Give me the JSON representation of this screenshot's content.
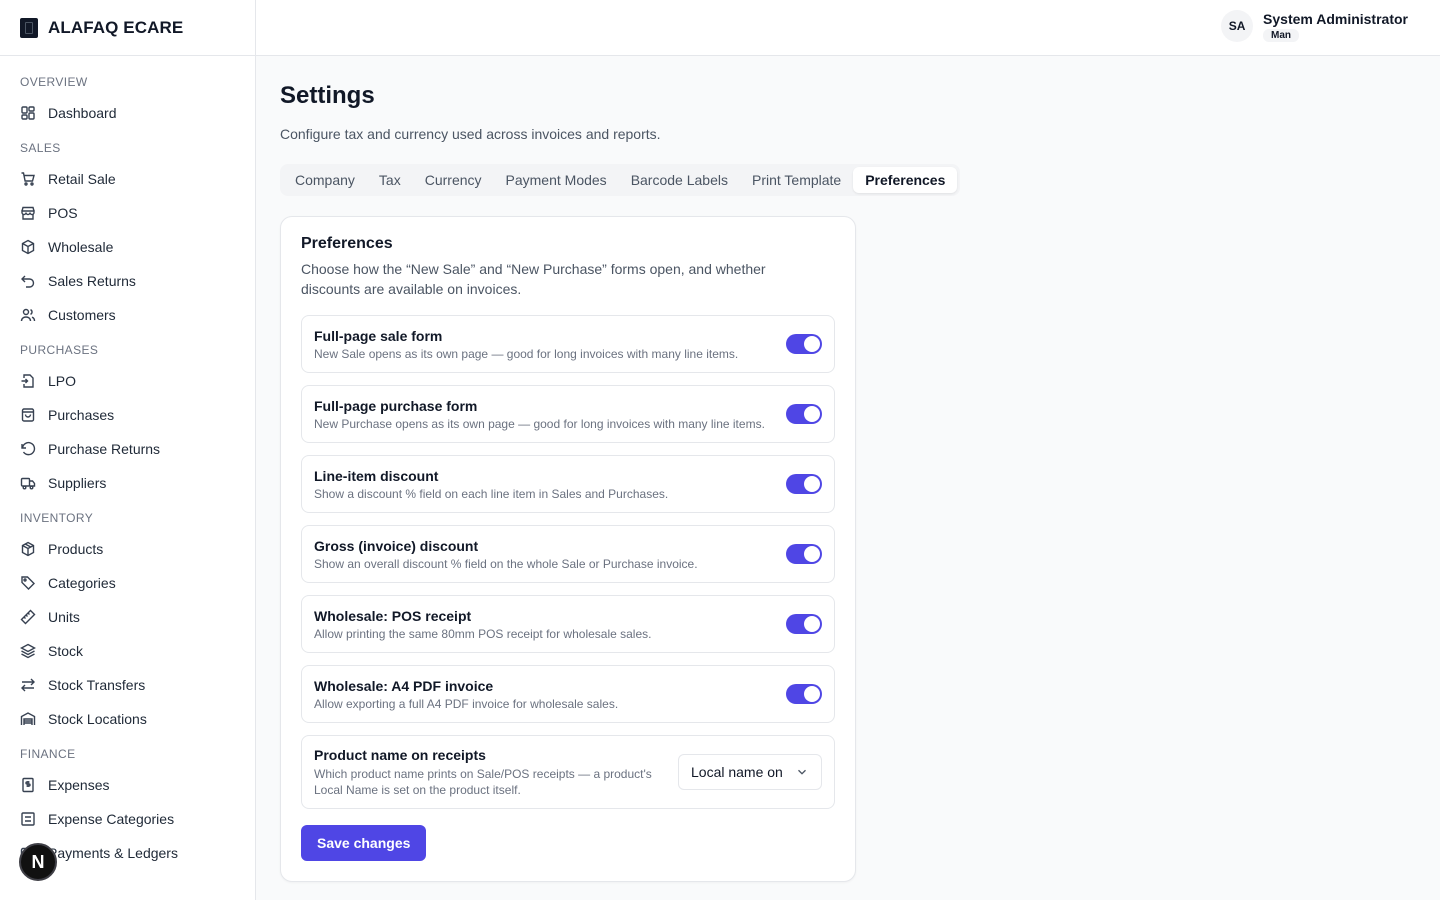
{
  "brand": {
    "name": "ALAFAQ ECARE"
  },
  "user": {
    "initials": "SA",
    "name": "System Administrator",
    "role": "Man"
  },
  "sidebar": {
    "sections": [
      {
        "heading": "Overview",
        "items": [
          {
            "label": "Dashboard",
            "icon": "dashboard-icon"
          }
        ]
      },
      {
        "heading": "Sales",
        "items": [
          {
            "label": "Retail Sale",
            "icon": "cart-icon"
          },
          {
            "label": "POS",
            "icon": "store-icon"
          },
          {
            "label": "Wholesale",
            "icon": "boxes-icon"
          },
          {
            "label": "Sales Returns",
            "icon": "undo-icon"
          },
          {
            "label": "Customers",
            "icon": "users-icon"
          }
        ]
      },
      {
        "heading": "Purchases",
        "items": [
          {
            "label": "LPO",
            "icon": "file-import-icon"
          },
          {
            "label": "Purchases",
            "icon": "shopping-bag-icon"
          },
          {
            "label": "Purchase Returns",
            "icon": "rotate-ccw-icon"
          },
          {
            "label": "Suppliers",
            "icon": "truck-icon"
          }
        ]
      },
      {
        "heading": "Inventory",
        "items": [
          {
            "label": "Products",
            "icon": "package-icon"
          },
          {
            "label": "Categories",
            "icon": "tag-icon"
          },
          {
            "label": "Units",
            "icon": "ruler-icon"
          },
          {
            "label": "Stock",
            "icon": "layers-icon"
          },
          {
            "label": "Stock Transfers",
            "icon": "arrows-transfer-icon"
          },
          {
            "label": "Stock Locations",
            "icon": "warehouse-icon"
          }
        ]
      },
      {
        "heading": "Finance",
        "items": [
          {
            "label": "Expenses",
            "icon": "receipt-icon"
          },
          {
            "label": "Expense Categories",
            "icon": "list-icon"
          },
          {
            "label": "Payments & Ledgers",
            "icon": "wallet-icon"
          }
        ]
      }
    ]
  },
  "page": {
    "title": "Settings",
    "subtitle": "Configure tax and currency used across invoices and reports."
  },
  "tabs": [
    {
      "label": "Company",
      "active": false
    },
    {
      "label": "Tax",
      "active": false
    },
    {
      "label": "Currency",
      "active": false
    },
    {
      "label": "Payment Modes",
      "active": false
    },
    {
      "label": "Barcode Labels",
      "active": false
    },
    {
      "label": "Print Template",
      "active": false
    },
    {
      "label": "Preferences",
      "active": true
    }
  ],
  "card": {
    "title": "Preferences",
    "description": "Choose how the “New Sale” and “New Purchase” forms open, and whether discounts are available on invoices.",
    "toggles": [
      {
        "label": "Full-page sale form",
        "help": "New Sale opens as its own page — good for long invoices with many line items.",
        "on": true
      },
      {
        "label": "Full-page purchase form",
        "help": "New Purchase opens as its own page — good for long invoices with many line items.",
        "on": true
      },
      {
        "label": "Line-item discount",
        "help": "Show a discount % field on each line item in Sales and Purchases.",
        "on": true
      },
      {
        "label": "Gross (invoice) discount",
        "help": "Show an overall discount % field on the whole Sale or Purchase invoice.",
        "on": true
      },
      {
        "label": "Wholesale: POS receipt",
        "help": "Allow printing the same 80mm POS receipt for wholesale sales.",
        "on": true
      },
      {
        "label": "Wholesale: A4 PDF invoice",
        "help": "Allow exporting a full A4 PDF invoice for wholesale sales.",
        "on": true
      }
    ],
    "receipt_name": {
      "label": "Product name on receipts",
      "help": "Which product name prints on Sale/POS receipts — a product's Local Name is set on the product itself.",
      "selected": "Local name on"
    },
    "save_label": "Save changes"
  },
  "floating_badge": {
    "letter": "N"
  },
  "colors": {
    "accent": "#4f46e5",
    "border": "#e5e7eb",
    "muted": "#6b7280"
  }
}
